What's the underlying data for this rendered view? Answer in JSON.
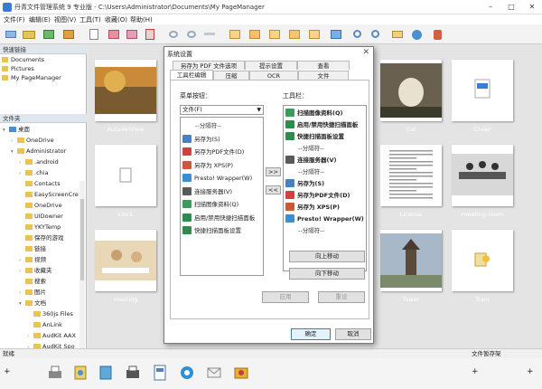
{
  "window": {
    "title": "丹青文件管理系统 9 专业版 - C:\\Users\\Administrator\\Documents\\My PageManager"
  },
  "menu": [
    "文件(F)",
    "编辑(E)",
    "视图(V)",
    "工具(T)",
    "收藏(O)",
    "帮助(H)"
  ],
  "quicklinks": {
    "header": "快速链接",
    "items": [
      "Documents",
      "Pictures",
      "My PageManager"
    ]
  },
  "folders": {
    "header": "文件夹",
    "items": [
      {
        "label": "桌面",
        "depth": 0,
        "exp": "v"
      },
      {
        "label": "OneDrive",
        "depth": 1,
        "exp": ">"
      },
      {
        "label": "Administrator",
        "depth": 1,
        "exp": "v"
      },
      {
        "label": ".android",
        "depth": 2,
        "exp": ">"
      },
      {
        "label": ".chia",
        "depth": 2,
        "exp": ">"
      },
      {
        "label": "Contacts",
        "depth": 2,
        "exp": ""
      },
      {
        "label": "EasyScreenCre",
        "depth": 2,
        "exp": ""
      },
      {
        "label": "OneDrive",
        "depth": 2,
        "exp": ""
      },
      {
        "label": "UIDowner",
        "depth": 2,
        "exp": ""
      },
      {
        "label": "YKYTemp",
        "depth": 2,
        "exp": ""
      },
      {
        "label": "保存的游戏",
        "depth": 2,
        "exp": ""
      },
      {
        "label": "链接",
        "depth": 2,
        "exp": ""
      },
      {
        "label": "视频",
        "depth": 2,
        "exp": ">"
      },
      {
        "label": "收藏夹",
        "depth": 2,
        "exp": ">"
      },
      {
        "label": "搜索",
        "depth": 2,
        "exp": ""
      },
      {
        "label": "图片",
        "depth": 2,
        "exp": ">"
      },
      {
        "label": "文档",
        "depth": 2,
        "exp": "v"
      },
      {
        "label": "360js Files",
        "depth": 3,
        "exp": ""
      },
      {
        "label": "AnLink",
        "depth": 3,
        "exp": ""
      },
      {
        "label": "AudKit AAX",
        "depth": 3,
        "exp": ">"
      },
      {
        "label": "AudKit Spo",
        "depth": 3,
        "exp": ">"
      }
    ]
  },
  "thumbnails": [
    {
      "label": "AutumnView",
      "kind": "photo-autumn"
    },
    {
      "label": "",
      "kind": "blank"
    },
    {
      "label": "",
      "kind": "blank"
    },
    {
      "label": "",
      "kind": "blank"
    },
    {
      "label": "Cat",
      "kind": "photo-cat"
    },
    {
      "label": "Cheer",
      "kind": "wav"
    },
    {
      "label": "clock",
      "kind": "doc"
    },
    {
      "label": "",
      "kind": "blank"
    },
    {
      "label": "",
      "kind": "blank"
    },
    {
      "label": "",
      "kind": "blank"
    },
    {
      "label": "License",
      "kind": "text"
    },
    {
      "label": "meeting-room",
      "kind": "photo-meeting"
    },
    {
      "label": "meeting",
      "kind": "photo-office"
    },
    {
      "label": "",
      "kind": "blank"
    },
    {
      "label": "",
      "kind": "blank"
    },
    {
      "label": "",
      "kind": "blank"
    },
    {
      "label": "Tower",
      "kind": "photo-tower"
    },
    {
      "label": "Train",
      "kind": "train"
    }
  ],
  "statusbar": {
    "left": "就绪",
    "right": "文件暂存架"
  },
  "dialog": {
    "title": "系统设置",
    "tabs_row1": [
      "另存为 PDF 文件选项",
      "提示设置",
      "查看"
    ],
    "tabs_row2": [
      "工具栏编辑",
      "压缩",
      "OCR",
      "文件"
    ],
    "menu_label": "菜单按钮：",
    "menu_select": "文件(F)",
    "toolbar_label": "工具栏：",
    "left_items": [
      {
        "label": "--分隔符--",
        "sep": true,
        "icon": ""
      },
      {
        "label": "另存为(S)",
        "icon": "#4a7fc4"
      },
      {
        "label": "另存为PDF文件(D)",
        "icon": "#d24040"
      },
      {
        "label": "另存为 XPS(P)",
        "icon": "#c85a3a"
      },
      {
        "label": "Presto! Wrapper(W)",
        "icon": "#3b8fd0"
      },
      {
        "label": "连接服务器(V)",
        "icon": "#5a5a5a"
      },
      {
        "label": "扫描图像资料(Q)",
        "icon": "#3c9a5a"
      },
      {
        "label": "启用/禁用快捷扫描面板",
        "icon": "#2f8c4c"
      },
      {
        "label": "快捷扫描面板设置",
        "icon": "#2f8c4c"
      }
    ],
    "right_items": [
      {
        "label": "扫描图像资料(Q)",
        "icon": "#3c9a5a",
        "bold": true
      },
      {
        "label": "启用/禁用快捷扫描面板",
        "icon": "#2f8c4c",
        "bold": true
      },
      {
        "label": "快捷扫描面板设置",
        "icon": "#2f8c4c",
        "bold": true
      },
      {
        "label": "--分隔符--",
        "sep": true,
        "icon": ""
      },
      {
        "label": "连接服务器(V)",
        "icon": "#5a5a5a",
        "bold": true
      },
      {
        "label": "--分隔符--",
        "sep": true,
        "icon": ""
      },
      {
        "label": "另存为(S)",
        "icon": "#4a7fc4",
        "bold": true
      },
      {
        "label": "另存为PDF文件(D)",
        "icon": "#d24040",
        "bold": true
      },
      {
        "label": "另存为 XPS(P)",
        "icon": "#c85a3a",
        "bold": true
      },
      {
        "label": "Presto! Wrapper(W)",
        "icon": "#3b8fd0",
        "bold": true
      },
      {
        "label": "--分隔符--",
        "sep": true,
        "icon": ""
      }
    ],
    "move_right": ">>",
    "move_left": "<<",
    "move_up": "向上移动",
    "move_down": "向下移动",
    "apply": "应用",
    "reset": "重设",
    "ok": "确定",
    "cancel": "取消"
  }
}
